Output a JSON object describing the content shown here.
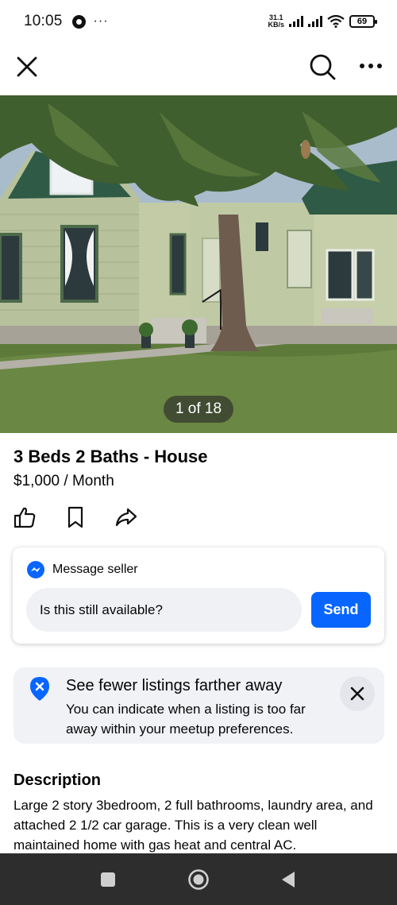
{
  "status_bar": {
    "time": "10:05",
    "more": "···",
    "net_speed_value": "31.1",
    "net_speed_unit": "KB/s",
    "battery": "69",
    "icons": [
      "whatsapp-icon",
      "signal-icon",
      "signal-icon",
      "wifi-icon",
      "battery-icon"
    ]
  },
  "top_bar": {
    "icons": [
      "close-icon",
      "search-icon",
      "more-icon"
    ]
  },
  "photo": {
    "counter": "1 of 18",
    "current_index": 1,
    "total": 18
  },
  "listing": {
    "title": "3 Beds 2 Baths - House",
    "price": "$1,000 / Month"
  },
  "actions": {
    "icons": [
      "like-icon",
      "save-icon",
      "share-icon"
    ]
  },
  "message": {
    "label": "Message seller",
    "input_value": "Is this still available?",
    "send_label": "Send"
  },
  "notice": {
    "title": "See fewer listings farther away",
    "body": "You can indicate when a listing is too far away within your meetup preferences."
  },
  "description": {
    "heading": "Description",
    "text": "Large 2 story 3bedroom, 2 full bathrooms, laundry area, and attached 2 1/2 car garage. This is a very clean well maintained home with gas heat and central AC."
  },
  "nav_bar": {
    "icons": [
      "recent-apps-icon",
      "home-icon",
      "back-icon"
    ]
  },
  "colors": {
    "accent": "#0866ff",
    "text": "#050505",
    "input_bg": "#eff1f4",
    "notice_bg": "#f0f2f5",
    "nav_bg": "#2d2d2d"
  }
}
